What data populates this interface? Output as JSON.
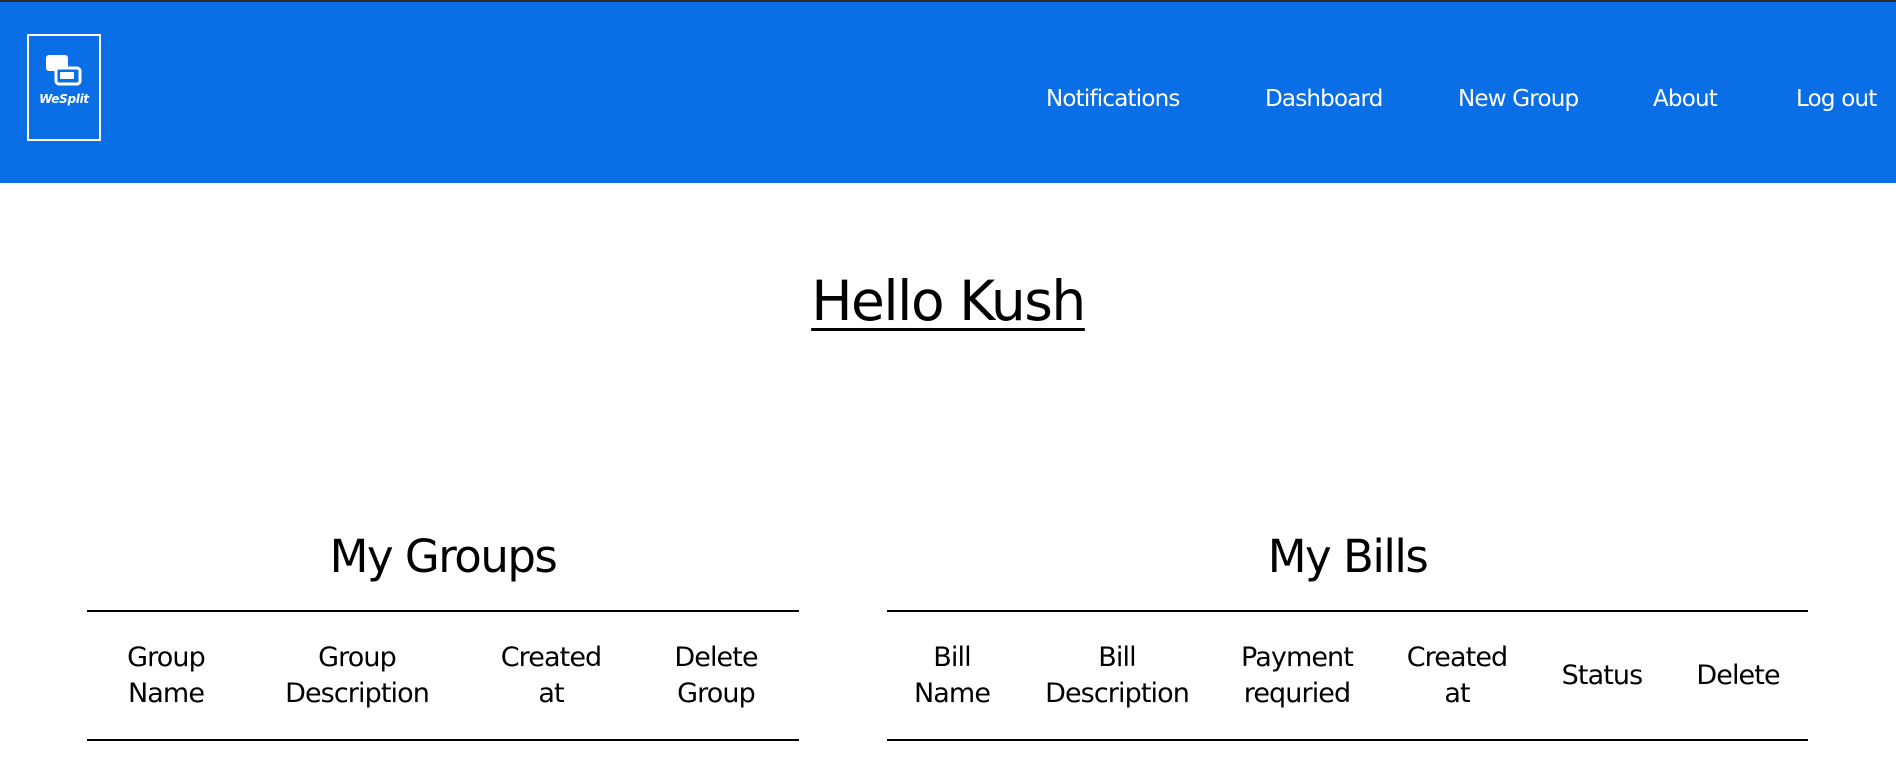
{
  "app": {
    "logo_text": "WeSplit",
    "brand_color": "#0a6ee6"
  },
  "nav": {
    "items": [
      {
        "label": "Notifications"
      },
      {
        "label": "Dashboard"
      },
      {
        "label": "New Group"
      },
      {
        "label": "About"
      },
      {
        "label": "Log out"
      }
    ]
  },
  "main": {
    "greeting": "Hello Kush"
  },
  "groups": {
    "title": "My Groups",
    "columns": [
      {
        "line1": "Group",
        "line2": "Name"
      },
      {
        "line1": "Group",
        "line2": "Description"
      },
      {
        "line1": "Created",
        "line2": "at"
      },
      {
        "line1": "Delete",
        "line2": "Group"
      }
    ]
  },
  "bills": {
    "title": "My Bills",
    "columns": [
      {
        "line1": "Bill",
        "line2": "Name"
      },
      {
        "line1": "Bill",
        "line2": "Description"
      },
      {
        "line1": "Payment",
        "line2": "requried"
      },
      {
        "line1": "Created",
        "line2": "at"
      },
      {
        "line1": "Status"
      },
      {
        "line1": "Delete"
      }
    ]
  }
}
